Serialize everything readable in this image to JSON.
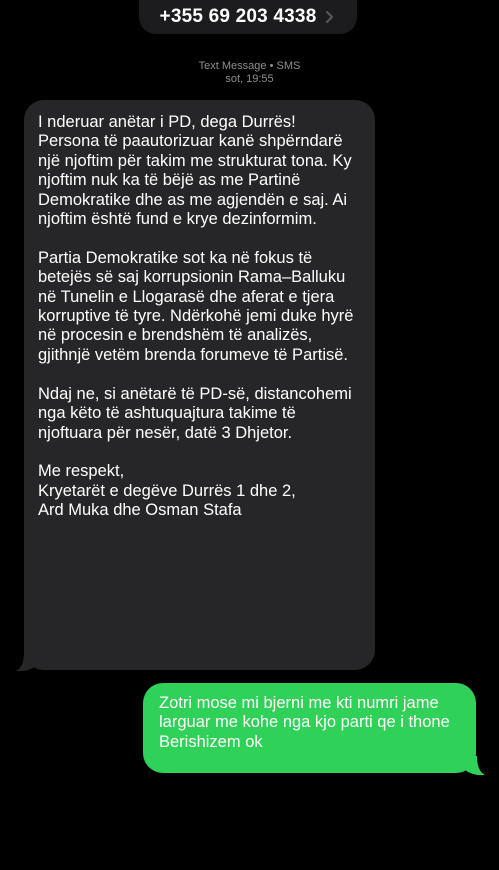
{
  "header": {
    "phone_number": "+355 69 203 4338",
    "chevron_icon": "chevron-right-icon"
  },
  "meta": {
    "service": "Text Message • SMS",
    "time": "sot, 19:55"
  },
  "messages": {
    "incoming": {
      "text": "I nderuar anëtar i PD, dega Durrës!\nPersona të paautorizuar kanë shpërndarë një njoftim për takim me strukturat tona. Ky njoftim nuk ka të bëjë as me Partinë Demokratike dhe as me agjendën e saj. Ai njoftim është fund e krye dezinformim.\n\nPartia Demokratike sot ka në fokus të betejës së saj korrupsionin Rama–Balluku në Tunelin e Llogarasë dhe aferat e tjera korruptive të tyre. Ndërkohë jemi duke hyrë në procesin e brendshëm të analizës, gjithnjë vetëm brenda forumeve të Partisë.\n\nNdaj ne, si anëtarë të PD-së, distancohemi nga këto të ashtuquajtura takime të njoftuara për nesër, datë 3 Dhjetor.\n\nMe respekt,\nKryetarët e degëve Durrës 1 dhe 2,\nArd Muka dhe Osman Stafa"
    },
    "outgoing": {
      "text": "Zotri mose mi bjerni me kti numri jame larguar me kohe nga kjo parti qe i thone Berishizem ok"
    }
  },
  "colors": {
    "background": "#000000",
    "incoming_bubble": "#262628",
    "outgoing_bubble": "#30d158",
    "meta_text": "#8e8e93"
  }
}
